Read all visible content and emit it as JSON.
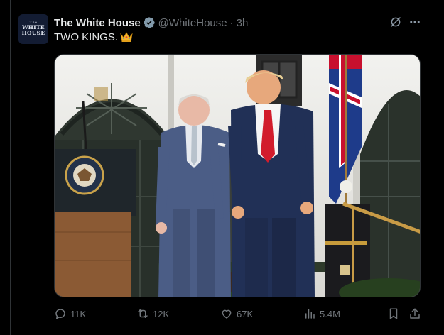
{
  "account": {
    "display_name": "The White House",
    "handle": "@WhiteHouse",
    "separator": "·",
    "time": "3h",
    "avatar_text": [
      "The",
      "WHITE",
      "HOUSE"
    ]
  },
  "tweet": {
    "text": "TWO KINGS.",
    "emoji_icon": "crown-icon"
  },
  "stats": {
    "replies": "11K",
    "reposts": "12K",
    "likes": "67K",
    "views": "5.4M"
  },
  "colors": {
    "background": "#000000",
    "text": "#e7e9ea",
    "muted": "#71767b",
    "border": "#2f3336",
    "verified": "#829aab"
  }
}
